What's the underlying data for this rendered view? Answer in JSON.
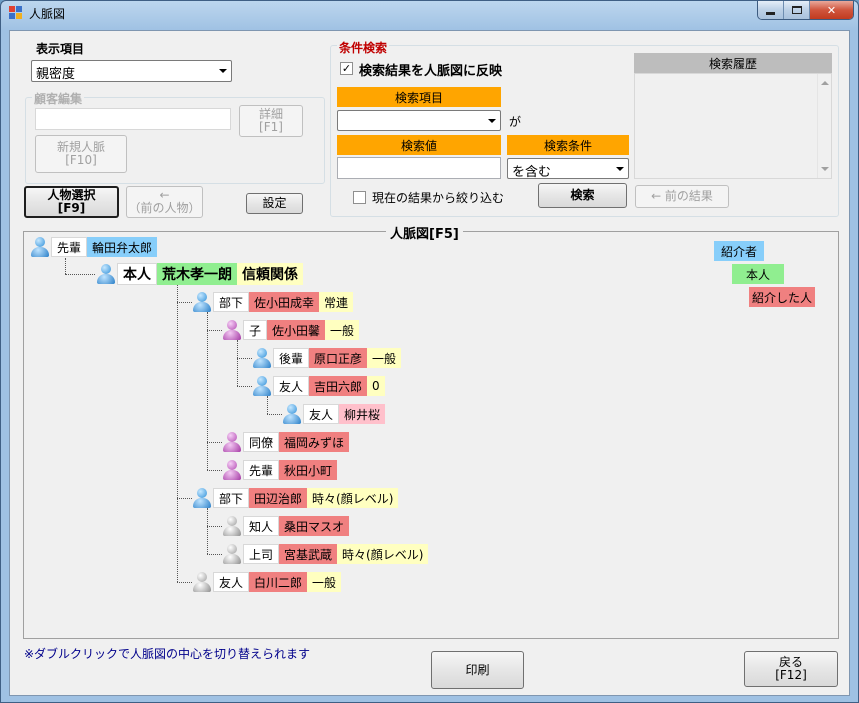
{
  "window": {
    "title": "人脈図"
  },
  "display": {
    "label": "表示項目",
    "selected": "親密度"
  },
  "customer_edit": {
    "label": "顧客編集",
    "detail_button": [
      "詳細",
      "[F1]"
    ],
    "new_button": [
      "新規人脈",
      "[F10]"
    ]
  },
  "person_select": {
    "label": [
      "人物選択",
      "[F9]"
    ]
  },
  "prev_person": {
    "label": [
      "←",
      "（前の人物）"
    ]
  },
  "settings": {
    "label": "設定"
  },
  "search": {
    "label": "条件検索",
    "reflect_checkbox": "検索結果を人脈図に反映",
    "item_label": "検索項目",
    "ga": "が",
    "value_label": "検索値",
    "condition_label": "検索条件",
    "condition_selected": "を含む",
    "narrow_checkbox": "現在の結果から絞り込む",
    "search_button": "検索",
    "prev_result_button": "← 前の結果",
    "history_label": "検索履歴"
  },
  "tree": {
    "title": "人脈図[F5]",
    "introducer": {
      "rel": "先輩",
      "name": "輪田弁太郎"
    },
    "self": {
      "rel": "本人",
      "name": "荒木孝一朗",
      "value": "信頼関係"
    },
    "nodes": [
      {
        "rel": "部下",
        "name": "佐小田成幸",
        "value": "常連"
      },
      {
        "rel": "子",
        "name": "佐小田馨",
        "value": "一般"
      },
      {
        "rel": "後輩",
        "name": "原口正彦",
        "value": "一般"
      },
      {
        "rel": "友人",
        "name": "吉田六郎",
        "value": "0"
      },
      {
        "rel": "友人",
        "name": "柳井桜",
        "value": ""
      },
      {
        "rel": "同僚",
        "name": "福岡みずほ",
        "value": ""
      },
      {
        "rel": "先輩",
        "name": "秋田小町",
        "value": ""
      },
      {
        "rel": "部下",
        "name": "田辺治郎",
        "value": "時々(顔レベル)"
      },
      {
        "rel": "知人",
        "name": "桑田マスオ",
        "value": ""
      },
      {
        "rel": "上司",
        "name": "宮基武蔵",
        "value": "時々(顔レベル)"
      },
      {
        "rel": "友人",
        "name": "白川二郎",
        "value": "一般"
      }
    ]
  },
  "legend": {
    "introducer": "紹介者",
    "self": "本人",
    "introduced": "紹介した人"
  },
  "hint": "※ダブルクリックで人脈図の中心を切り替えられます",
  "print_button": "印刷",
  "back_button": [
    "戻る",
    "[F12]"
  ]
}
